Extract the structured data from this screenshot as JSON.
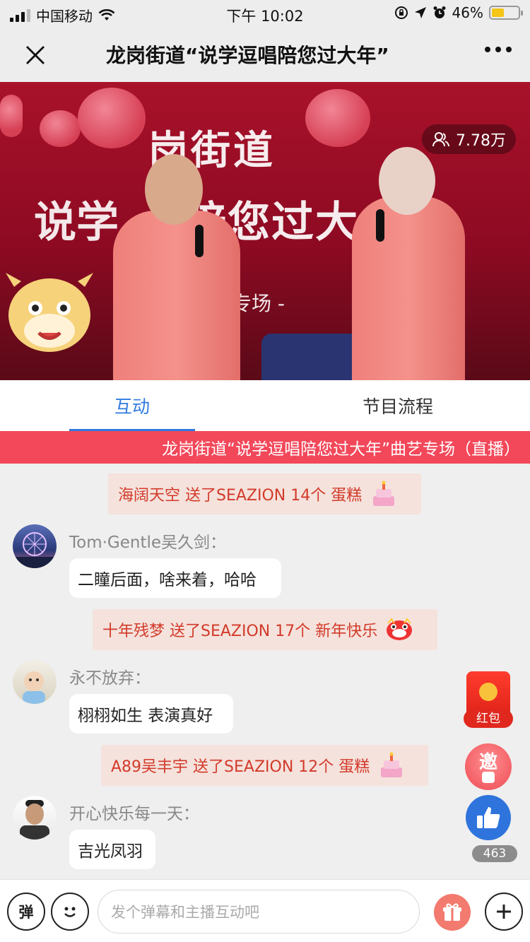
{
  "status_bar": {
    "carrier": "中国移动",
    "time": "下午 10:02",
    "battery": "46%",
    "battery_level": 0.46
  },
  "nav": {
    "title": "龙岗街道“说学逗唱陪您过大年”"
  },
  "video": {
    "banner_line1": "岗街道",
    "banner_line2": "陪您过大",
    "banner_side": "说学",
    "banner_sub": "专场 -",
    "viewers": "7.78万"
  },
  "tabs": [
    {
      "label": "互动",
      "active": true
    },
    {
      "label": "节目流程",
      "active": false
    }
  ],
  "ticker": "龙岗街道“说学逗唱陪您过大年”曲艺专场（直播）",
  "chat": {
    "gifts": [
      {
        "text": "海阔天空  送了SEAZION 14个  蛋糕",
        "icon": "cake-icon"
      },
      {
        "text": "十年残梦  送了SEAZION 17个  新年快乐",
        "icon": "lion-dance-icon"
      },
      {
        "text": "A89吴丰宇  送了SEAZION 12个  蛋糕",
        "icon": "cake-icon"
      }
    ],
    "messages": [
      {
        "name": "Tom·Gentle吴久剑：",
        "text": "二瞳后面，啥来着，哈哈"
      },
      {
        "name": "永不放弃：",
        "text": "栩栩如生 表演真好"
      },
      {
        "name": "开心快乐每一天：",
        "text": "吉光凤羽"
      }
    ]
  },
  "side": {
    "red_packet_label": "红包",
    "invite_label": "邀",
    "like_count": "463"
  },
  "bottom": {
    "danmu_label": "弹",
    "input_placeholder": "发个弹幕和主播互动吧"
  },
  "colors": {
    "accent": "#2f7ae0",
    "ticker": "#f2485a",
    "gift_bg": "#f5e2dc",
    "gift_text": "#d23a2a"
  }
}
